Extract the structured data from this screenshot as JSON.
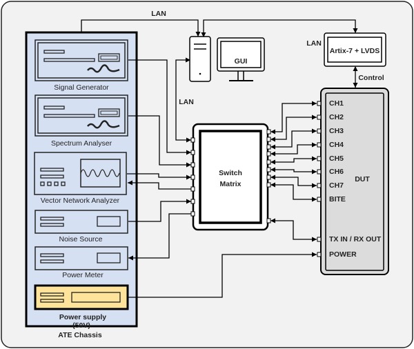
{
  "labels": {
    "lan_top": "LAN",
    "lan_side": "LAN",
    "lan_artix": "LAN",
    "control": "Control",
    "gui": "GUI",
    "artix": "Artix-7 + LVDS",
    "switch_line1": "Switch",
    "switch_line2": "Matrix",
    "dut": "DUT",
    "ate_chassis": "ATE Chassis"
  },
  "instruments": {
    "signal_generator": "Signal Generator",
    "spectrum_analyser": "Spectrum Analyser",
    "vna": "Vector Network Analyzer",
    "noise_source": "Noise Source",
    "power_meter": "Power Meter",
    "power_supply": "Power supply",
    "power_supply_voltage": "(50V)"
  },
  "dut_ports": [
    "CH1",
    "CH2",
    "CH3",
    "CH4",
    "CH5",
    "CH6",
    "CH7",
    "BITE",
    "TX IN / RX OUT",
    "POWER"
  ],
  "colors": {
    "background": "#f2f2f2",
    "chassis": "#d6e0f3",
    "power_supply": "#fde49a",
    "dut": "#dcdcdc"
  }
}
